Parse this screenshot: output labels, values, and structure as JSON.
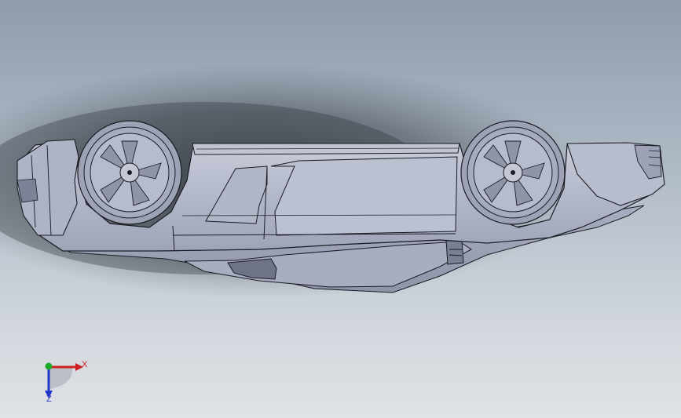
{
  "viewport": {
    "background_top": "#8e9cac",
    "background_bottom": "#dfe2e6",
    "model_color": "#b7bccd",
    "edge_color": "#1a1c24"
  },
  "model": {
    "description_icon": "upside-down-car-model-icon"
  },
  "triad": {
    "x_label": "X",
    "z_label": "Z",
    "x_color": "#cc1f1f",
    "y_color": "#1faa2a",
    "z_color": "#2436c8"
  }
}
